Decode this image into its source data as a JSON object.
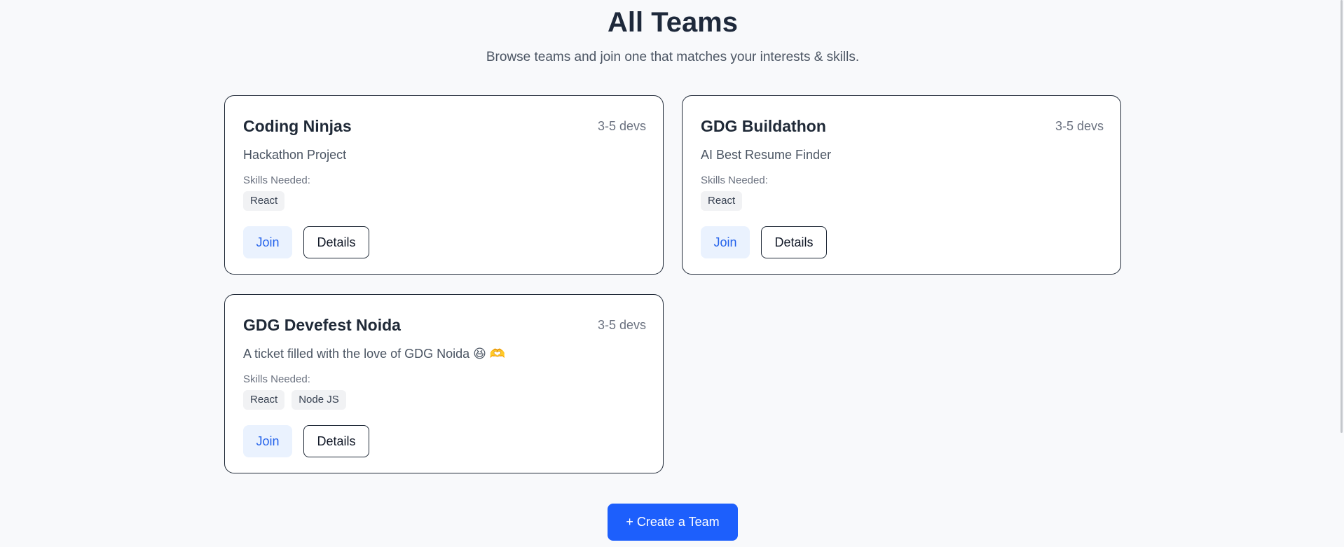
{
  "header": {
    "title": "All Teams",
    "subtitle": "Browse teams and join one that matches your interests & skills."
  },
  "teams": [
    {
      "name": "Coding Ninjas",
      "size": "3-5 devs",
      "description": "Hackathon Project",
      "skills_label": "Skills Needed:",
      "skills": [
        "React"
      ],
      "join_label": "Join",
      "details_label": "Details"
    },
    {
      "name": "GDG Buildathon",
      "size": "3-5 devs",
      "description": "AI Best Resume Finder",
      "skills_label": "Skills Needed:",
      "skills": [
        "React"
      ],
      "join_label": "Join",
      "details_label": "Details"
    },
    {
      "name": "GDG Devefest Noida",
      "size": "3-5 devs",
      "description": "A ticket filled with the love of GDG Noida 😆 🫶",
      "skills_label": "Skills Needed:",
      "skills": [
        "React",
        "Node JS"
      ],
      "join_label": "Join",
      "details_label": "Details"
    }
  ],
  "create_button_label": "+ Create a Team",
  "colors": {
    "primary": "#1d5ffc",
    "join_bg": "#eaf2fe",
    "join_text": "#2563eb",
    "page_bg": "#f8f9fb"
  }
}
